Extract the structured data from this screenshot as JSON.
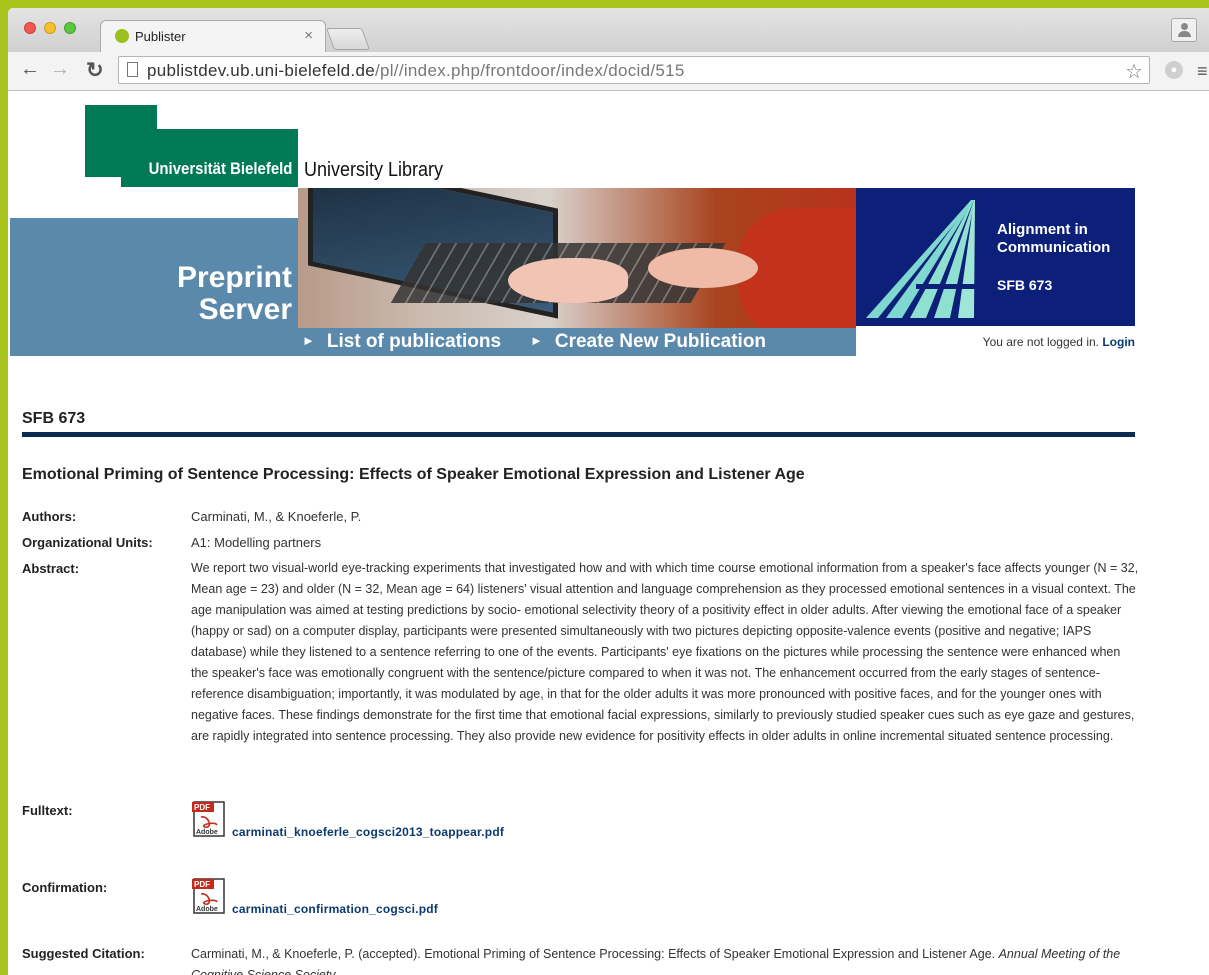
{
  "browser": {
    "tab_title": "Publister",
    "tab_close": "×",
    "url_host": "publistdev.ub.uni-bielefeld.de",
    "url_path": "/pl//index.php/frontdoor/index/docid/515",
    "back_icon": "arrow-left-icon",
    "forward_icon": "arrow-right-icon",
    "reload_icon": "reload-icon",
    "star_icon": "star-icon",
    "menu_icon": "hamburger-menu-icon"
  },
  "header": {
    "university": "Universität Bielefeld",
    "library": "University Library",
    "server_line1": "Preprint",
    "server_line2": "Server",
    "nav": [
      {
        "label": "List of publications"
      },
      {
        "label": "Create New Publication"
      }
    ],
    "sfb_logo_line1": "Alignment in",
    "sfb_logo_line2": "Communication",
    "sfb_logo_code": "SFB 673",
    "login_text": "You are not logged in.",
    "login_link": "Login"
  },
  "colors": {
    "university_green": "#007a55",
    "header_blue": "#5b89ab",
    "sfb_navy": "#0c1f79",
    "rule_navy": "#0b2a55",
    "link_blue": "#0b3a6e"
  },
  "document": {
    "section": "SFB 673",
    "title": "Emotional Priming of Sentence Processing: Effects of Speaker Emotional Expression and Listener Age",
    "fields": {
      "authors_label": "Authors:",
      "authors": "Carminati, M., & Knoeferle, P.",
      "units_label": "Organizational Units:",
      "units": "A1: Modelling partners",
      "abstract_label": "Abstract:",
      "abstract": "We report two visual-world eye-tracking experiments that investigated how and with which time course emotional information from a speaker's face affects younger (N = 32, Mean age = 23) and older (N = 32, Mean age = 64) listeners' visual attention and language comprehension as they processed emotional sentences in a visual context. The age manipulation was aimed at testing predictions by socio- emotional selectivity theory of a positivity effect in older adults. After viewing the emotional face of a speaker (happy or sad) on a computer display, participants were presented simultaneously with two pictures depicting opposite-valence events (positive and negative; IAPS database) while they listened to a sentence referring to one of the events. Participants' eye fixations on the pictures while processing the sentence were enhanced when the speaker's face was emotionally congruent with the sentence/picture compared to when it was not. The enhancement occurred from the early stages of sentence-reference disambiguation; importantly, it was modulated by age, in that for the older adults it was more pronounced with positive faces, and for the younger ones with negative faces. These findings demonstrate for the first time that emotional facial expressions, similarly to previously studied speaker cues such as eye gaze and gestures, are rapidly integrated into sentence processing. They also provide new evidence for positivity effects in older adults in online incremental situated sentence processing.",
      "fulltext_label": "Fulltext:",
      "fulltext_file": "carminati_knoeferle_cogsci2013_toappear.pdf",
      "confirmation_label": "Confirmation:",
      "confirmation_file": "carminati_confirmation_cogsci.pdf",
      "citation_label": "Suggested Citation:",
      "citation_plain": "Carminati, M., & Knoeferle, P. (accepted). Emotional Priming of Sentence Processing: Effects of Speaker Emotional Expression and Listener Age. ",
      "citation_italic": "Annual Meeting of the Cognitive Science Society",
      "citation_end": "."
    },
    "pdf_icon": "pdf-file-icon",
    "pdf_icon_top": "PDF",
    "pdf_icon_bottom": "Adobe"
  }
}
